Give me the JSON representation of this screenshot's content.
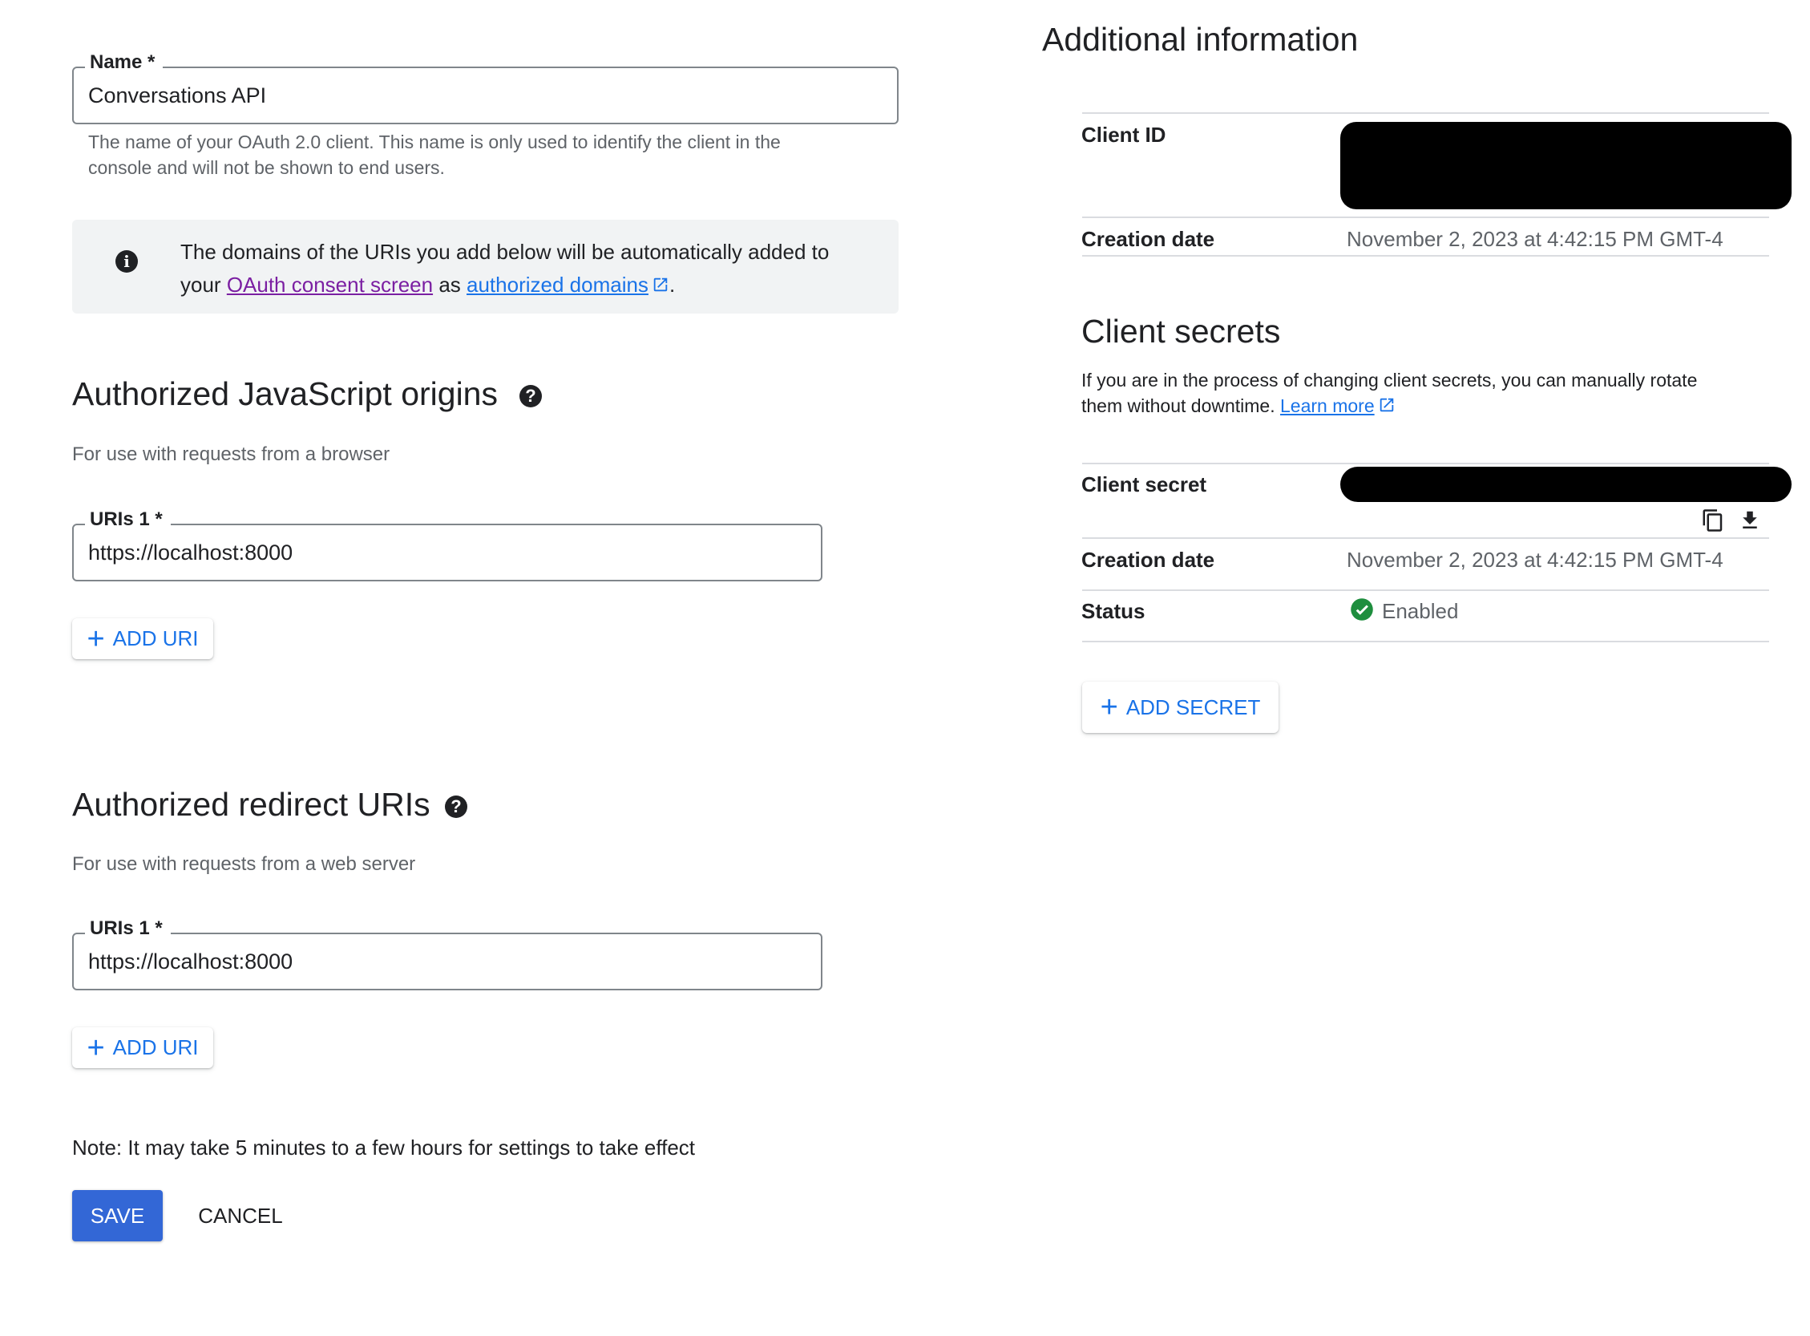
{
  "name_field": {
    "label": "Name *",
    "value": "Conversations API",
    "helper_line1": "The name of your OAuth 2.0 client. This name is only used to identify the client in the",
    "helper_line2": "console and will not be shown to end users."
  },
  "info_box": {
    "line1": "The domains of the URIs you add below will be automatically added to",
    "line2_prefix": "your",
    "link1": "OAuth consent screen",
    "middle": "as",
    "link2": "authorized domains",
    "suffix": "."
  },
  "js_origins": {
    "title": "Authorized JavaScript origins",
    "subtitle": "For use with requests from a browser",
    "uri_label": "URIs 1 *",
    "uri_value": "https://localhost:8000",
    "add_button": "ADD URI"
  },
  "redirect_uris": {
    "title": "Authorized redirect URIs",
    "subtitle": "For use with requests from a web server",
    "uri_label": "URIs 1 *",
    "uri_value": "https://localhost:8000",
    "add_button": "ADD URI"
  },
  "note": "Note: It may take 5 minutes to a few hours for settings to take effect",
  "actions": {
    "save": "SAVE",
    "cancel": "CANCEL"
  },
  "additional_info": {
    "title": "Additional information",
    "client_id_label": "Client ID",
    "creation_date_label": "Creation date",
    "creation_date_value": "November 2, 2023 at 4:42:15 PM GMT-4"
  },
  "client_secrets": {
    "title": "Client secrets",
    "desc_line1": "If you are in the process of changing client secrets, you can manually rotate",
    "desc_line2": "them without downtime.",
    "learn_more": "Learn more",
    "secret_label": "Client secret",
    "creation_date_label": "Creation date",
    "creation_date_value": "November 2, 2023 at 4:42:15 PM GMT-4",
    "status_label": "Status",
    "status_value": "Enabled",
    "add_button": "ADD SECRET"
  },
  "colors": {
    "accent": "#1a73e8",
    "primary_button": "#3367d6",
    "visited_link": "#7b1fa2",
    "success": "#1e8e3e",
    "redaction": "#000000"
  },
  "icons": [
    "info-icon",
    "help-icon",
    "external-link-icon",
    "plus-icon",
    "copy-icon",
    "download-icon",
    "check-circle-icon"
  ]
}
